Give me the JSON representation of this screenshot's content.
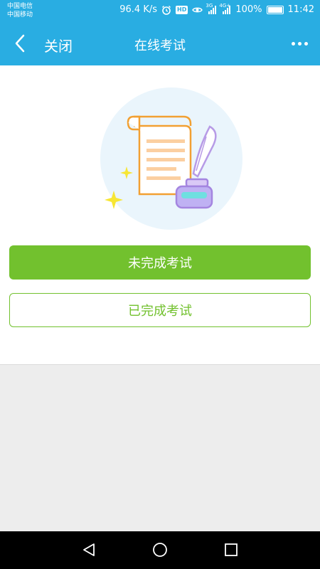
{
  "status_bar": {
    "carrier_1": "中国电信",
    "carrier_2": "中国移动",
    "speed": "96.4 K/s",
    "hd_badge": "HD",
    "network_1": "3G",
    "network_2": "4G+",
    "battery": "100%",
    "battery_level": 1.0,
    "time": "11:42",
    "icons": [
      "alarm-icon",
      "hd-icon",
      "eye-icon",
      "signal-icon",
      "signal-icon",
      "battery-icon"
    ]
  },
  "app_bar": {
    "close_label": "关闭",
    "title": "在线考试",
    "icons": [
      "back-icon",
      "more-icon"
    ]
  },
  "main": {
    "illustration": "exam-paper-and-quill",
    "unfinished_button": "未完成考试",
    "finished_button": "已完成考试"
  },
  "nav_bar": {
    "icons": [
      "back-triangle-icon",
      "home-circle-icon",
      "recents-square-icon"
    ]
  },
  "colors": {
    "primary": "#29ade2",
    "accent_green": "#72c12e",
    "page_bg": "#ededed",
    "nav_bg": "#000000"
  }
}
